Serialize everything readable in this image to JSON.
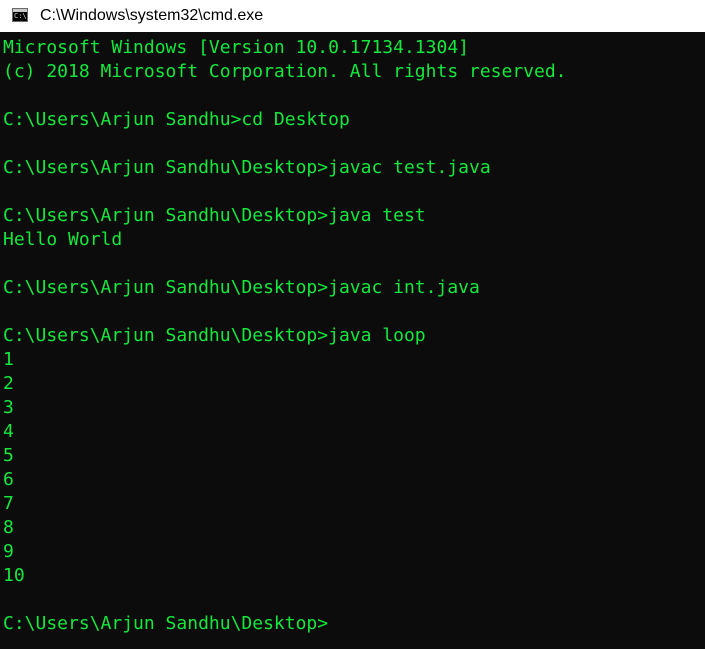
{
  "window": {
    "title": "C:\\Windows\\system32\\cmd.exe",
    "icon": "cmd-icon",
    "icon_glyph": "C:\\."
  },
  "colors": {
    "console_background": "#0c0c0c",
    "console_text": "#13e83d",
    "titlebar_background": "#ffffff"
  },
  "console": {
    "lines": [
      "Microsoft Windows [Version 10.0.17134.1304]",
      "(c) 2018 Microsoft Corporation. All rights reserved.",
      "",
      "C:\\Users\\Arjun Sandhu>cd Desktop",
      "",
      "C:\\Users\\Arjun Sandhu\\Desktop>javac test.java",
      "",
      "C:\\Users\\Arjun Sandhu\\Desktop>java test",
      "Hello World",
      "",
      "C:\\Users\\Arjun Sandhu\\Desktop>javac int.java",
      "",
      "C:\\Users\\Arjun Sandhu\\Desktop>java loop",
      "1",
      "2",
      "3",
      "4",
      "5",
      "6",
      "7",
      "8",
      "9",
      "10",
      "",
      "C:\\Users\\Arjun Sandhu\\Desktop>"
    ]
  }
}
